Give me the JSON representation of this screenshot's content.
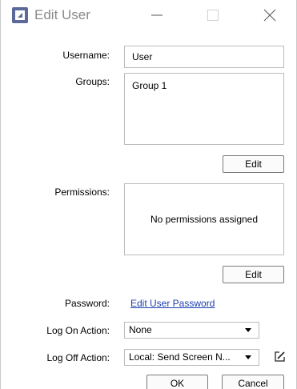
{
  "window": {
    "title": "Edit User",
    "icons": {
      "app": "app-logo-icon",
      "minimize": "minimize-icon",
      "maximize": "maximize-icon",
      "close": "close-icon"
    }
  },
  "form": {
    "username": {
      "label": "Username:",
      "value": "User"
    },
    "groups": {
      "label": "Groups:",
      "items": [
        "Group 1"
      ],
      "edit_label": "Edit"
    },
    "permissions": {
      "label": "Permissions:",
      "empty_text": "No permissions assigned",
      "edit_label": "Edit"
    },
    "password": {
      "label": "Password:",
      "link_text": "Edit User Password"
    },
    "log_on_action": {
      "label": "Log On Action:",
      "selected": "None"
    },
    "log_off_action": {
      "label": "Log Off Action:",
      "selected": "Local: Send Screen N...",
      "edit_icon": "edit-icon"
    }
  },
  "footer": {
    "ok_label": "OK",
    "cancel_label": "Cancel"
  },
  "colors": {
    "link": "#1a3fb0",
    "title_text": "#8a8a8a",
    "app_icon_bg": "#5b6a9a"
  }
}
